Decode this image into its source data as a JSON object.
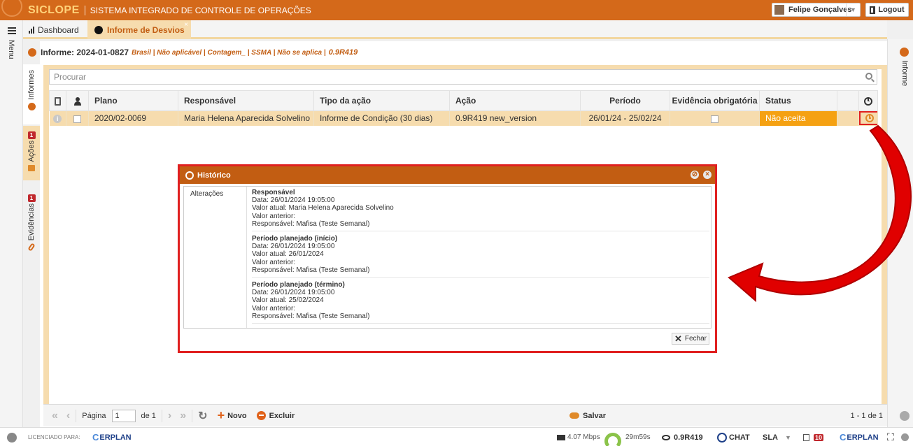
{
  "topbar": {
    "logo": "SICLOPE",
    "system_name": "SISTEMA INTEGRADO DE CONTROLE DE OPERAÇÕES",
    "user": "Felipe Gonçalves",
    "logout": "Logout"
  },
  "left_rail": {
    "menu": "Menu"
  },
  "vtabs": [
    {
      "label": "Informes",
      "badge": ""
    },
    {
      "label": "Ações",
      "badge": "1"
    },
    {
      "label": "Evidências",
      "badge": "1"
    }
  ],
  "tabs": {
    "dashboard": "Dashboard",
    "informe": "Informe de Desvios",
    "close": "×"
  },
  "informe": {
    "title": "Informe: 2024-01-0827",
    "meta": "Brasil | Não aplicável | Contagem_ | SSMA | Não se aplica |",
    "version": "0.9R419"
  },
  "search": {
    "placeholder": "Procurar"
  },
  "grid": {
    "headers": [
      "Plano",
      "Responsável",
      "Tipo da ação",
      "Ação",
      "Período",
      "Evidência obrigatória",
      "Status"
    ],
    "row": {
      "plano": "2020/02-0069",
      "responsavel": "Maria Helena Aparecida Solvelino",
      "tipo": "Informe de Condição (30 dias)",
      "acao": "0.9R419 new_version",
      "periodo": "26/01/24 - 25/02/24",
      "status": "Não aceita",
      "info": "i"
    }
  },
  "modal": {
    "title": "Histórico",
    "label": "Alterações",
    "entries": [
      {
        "title": "Responsável",
        "data": "Data: 26/01/2024 19:05:00",
        "atual": "Valor atual: Maria Helena Aparecida Solvelino",
        "anterior": "Valor anterior:",
        "responsavel": "Responsável: Mafisa (Teste Semanal)"
      },
      {
        "title": "Período planejado (início)",
        "data": "Data: 26/01/2024 19:05:00",
        "atual": "Valor atual: 26/01/2024",
        "anterior": "Valor anterior:",
        "responsavel": "Responsável: Mafisa (Teste Semanal)"
      },
      {
        "title": "Período planejado (término)",
        "data": "Data: 26/01/2024 19:05:00",
        "atual": "Valor atual: 25/02/2024",
        "anterior": "Valor anterior:",
        "responsavel": "Responsável: Mafisa (Teste Semanal)"
      }
    ],
    "close": "Fechar"
  },
  "pager": {
    "page_label": "Página",
    "page_value": "1",
    "of": "de 1",
    "novo": "Novo",
    "excluir": "Excluir",
    "salvar": "Salvar",
    "count": "1 - 1 de 1"
  },
  "right_rail": {
    "label": "Informe"
  },
  "statusbar": {
    "licensed": "LICENCIADO PARA:",
    "erplan": "ERPLAN",
    "speed": "4.07 Mbps",
    "timer": "29m59s",
    "version": "0.9R419",
    "chat": "CHAT",
    "sla": "SLA",
    "notif": "10",
    "erplan2": "ERPLAN"
  }
}
